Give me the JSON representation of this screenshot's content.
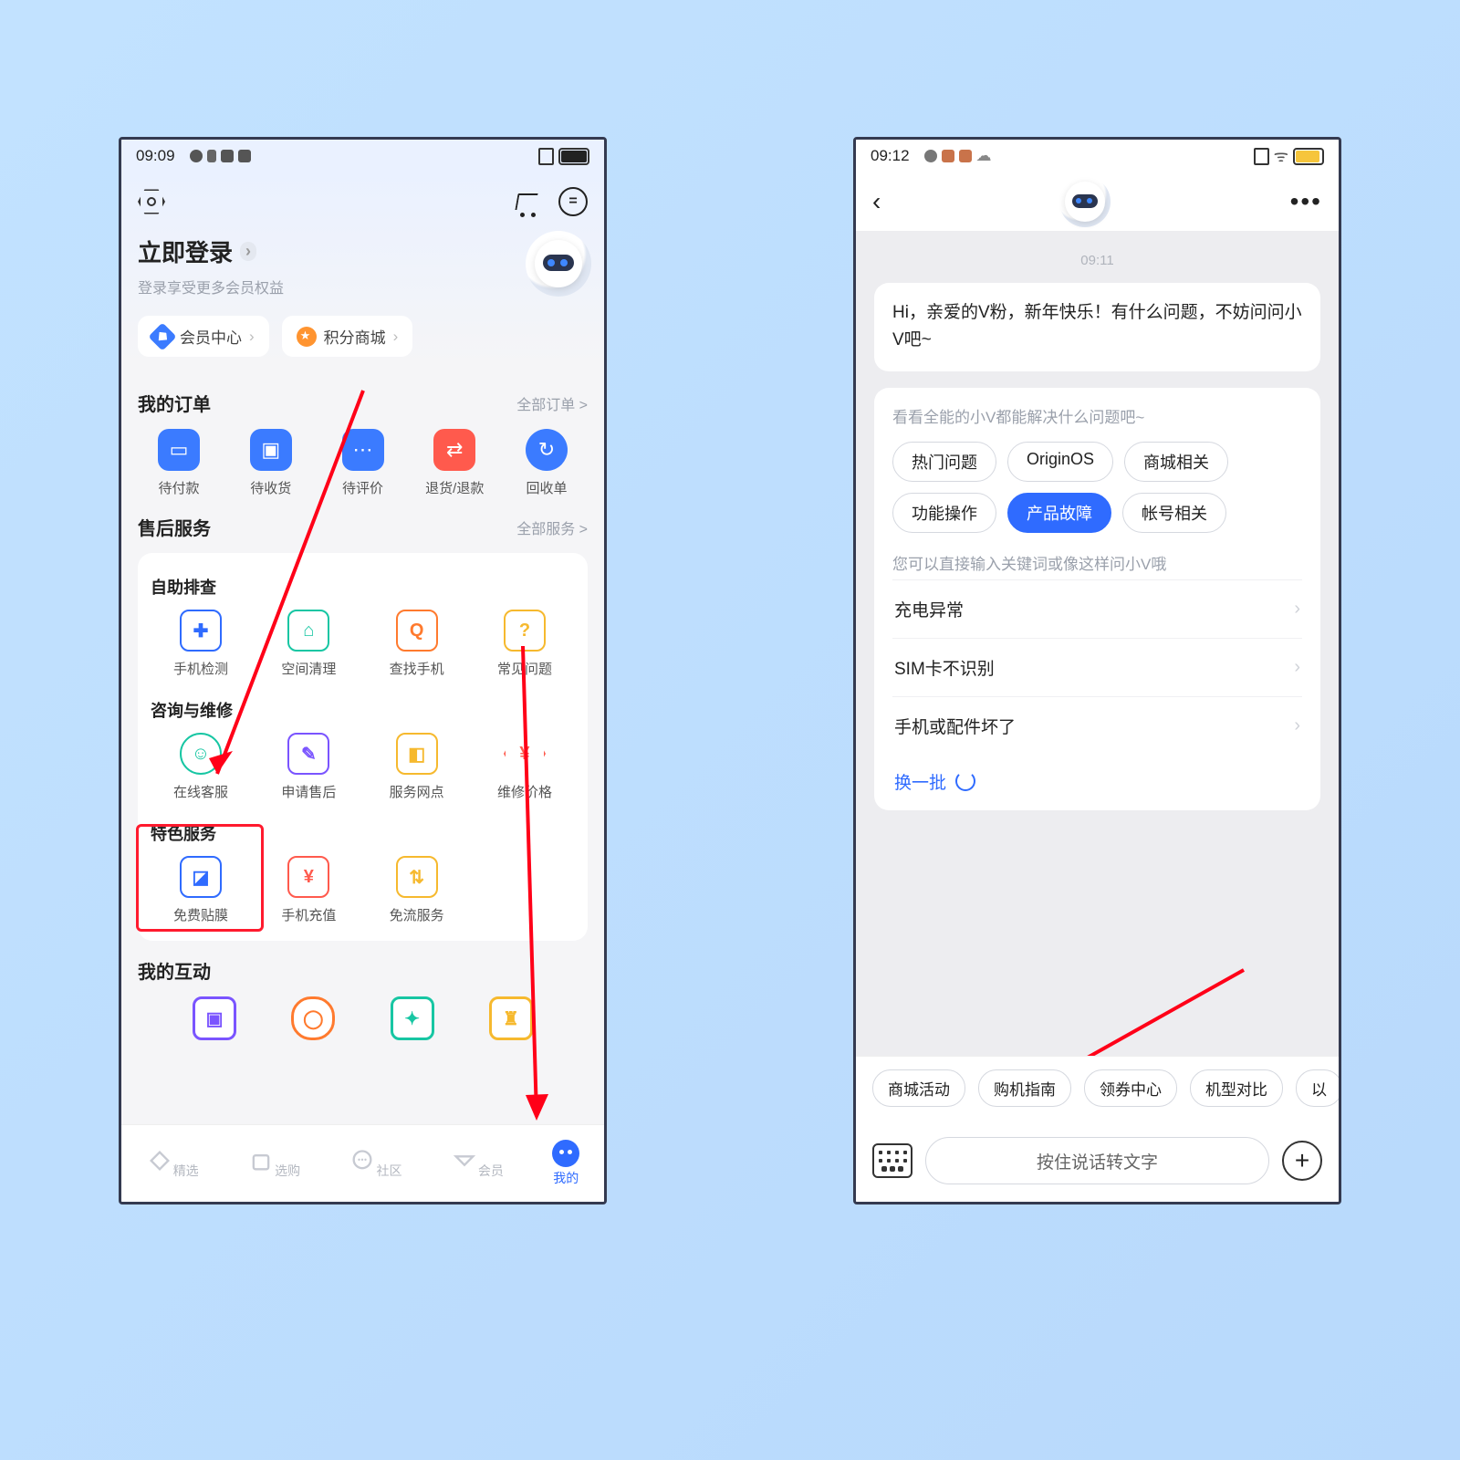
{
  "screen1": {
    "status": {
      "time": "09:09"
    },
    "login": {
      "title": "立即登录",
      "sub": "登录享受更多会员权益"
    },
    "pills": {
      "member": "会员中心",
      "mall": "积分商城"
    },
    "orders": {
      "title": "我的订单",
      "more": "全部订单 >",
      "items": [
        "待付款",
        "待收货",
        "待评价",
        "退货/退款",
        "回收单"
      ]
    },
    "service": {
      "title": "售后服务",
      "more": "全部服务 >",
      "g1": {
        "title": "自助排查",
        "items": [
          "手机检测",
          "空间清理",
          "查找手机",
          "常见问题"
        ]
      },
      "g2": {
        "title": "咨询与维修",
        "items": [
          "在线客服",
          "申请售后",
          "服务网点",
          "维修价格"
        ]
      },
      "g3": {
        "title": "特色服务",
        "items": [
          "免费贴膜",
          "手机充值",
          "免流服务"
        ]
      }
    },
    "interact": {
      "title": "我的互动"
    },
    "nav": [
      "精选",
      "选购",
      "社区",
      "会员",
      "我的"
    ]
  },
  "screen2": {
    "status": {
      "time": "09:12"
    },
    "ts": "09:11",
    "greet": "Hi，亲爱的V粉，新年快乐！有什么问题，不妨问问小V吧~",
    "panel": {
      "hint": "看看全能的小V都能解决什么问题吧~",
      "chips": [
        "热门问题",
        "OriginOS",
        "商城相关",
        "功能操作",
        "产品故障",
        "帐号相关"
      ],
      "active": 4,
      "hint2": "您可以直接输入关键词或像这样问小V哦",
      "qs": [
        "充电异常",
        "SIM卡不识别",
        "手机或配件坏了"
      ],
      "refresh": "换一批"
    },
    "suggest": [
      "商城活动",
      "购机指南",
      "领券中心",
      "机型对比",
      "以"
    ],
    "input": "按住说话转文字"
  }
}
